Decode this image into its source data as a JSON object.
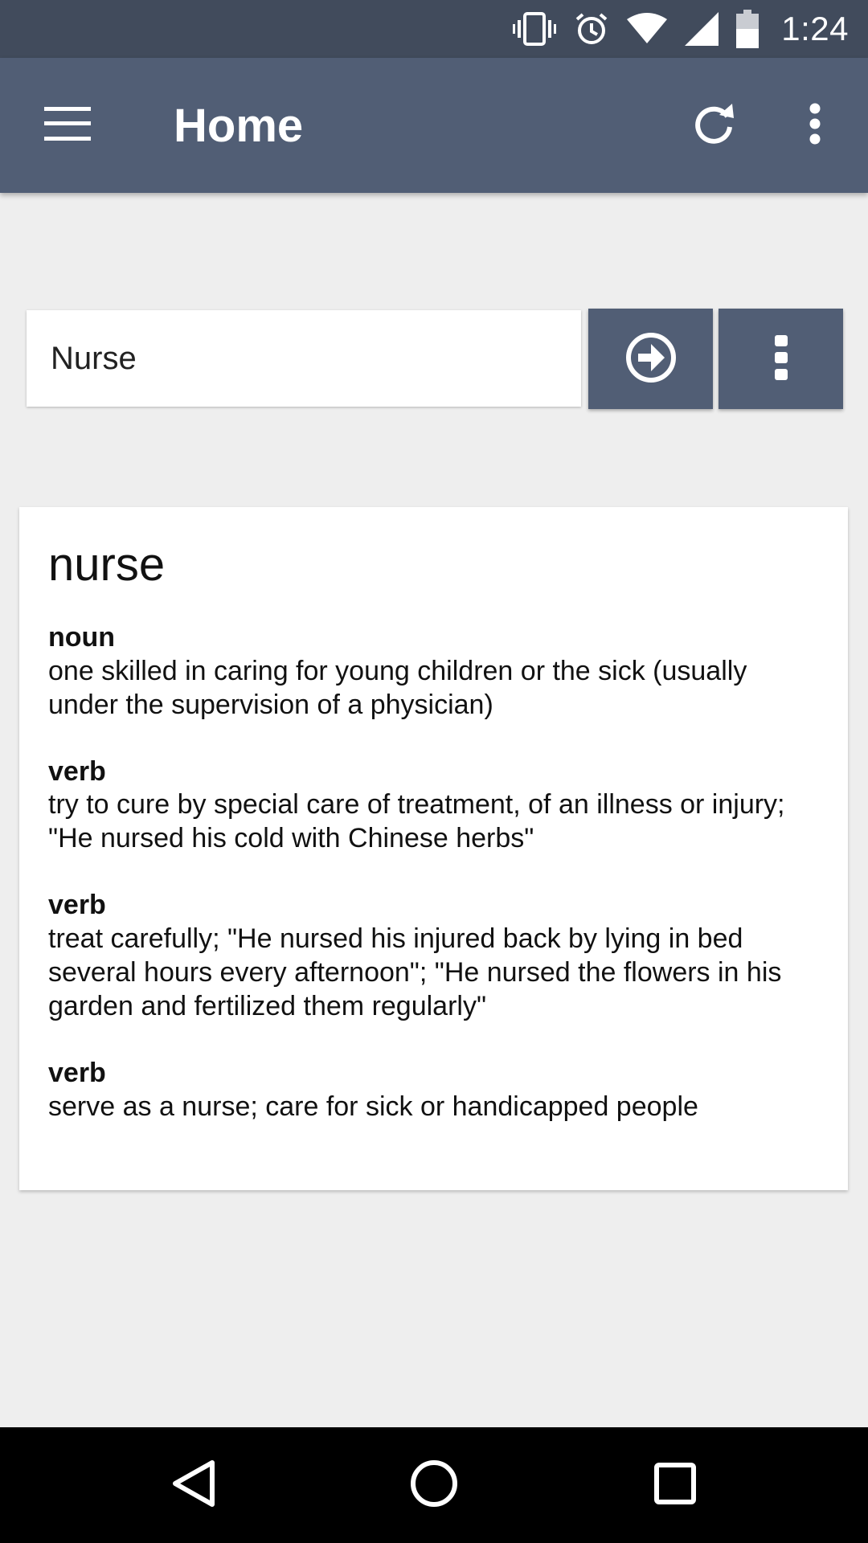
{
  "status_bar": {
    "time": "1:24",
    "icons": [
      "vibrate-icon",
      "alarm-icon",
      "wifi-icon",
      "cell-signal-icon",
      "battery-icon"
    ]
  },
  "app_bar": {
    "title": "Home",
    "icons": [
      "menu-icon",
      "refresh-icon",
      "overflow-menu-icon"
    ]
  },
  "search": {
    "value": "Nurse",
    "go_icon": "arrow-right-circle-icon",
    "more_icon": "overflow-menu-icon"
  },
  "definition": {
    "word": "nurse",
    "senses": [
      {
        "pos": "noun",
        "text": "one skilled in caring for young children or the sick (usually under the supervision of a physician)"
      },
      {
        "pos": "verb",
        "text": "try to cure by special care of treatment, of an illness or injury; \"He nursed his cold with Chinese herbs\""
      },
      {
        "pos": "verb",
        "text": "treat carefully; \"He nursed his injured back by lying in bed several hours every afternoon\"; \"He nursed the flowers in his garden and fertilized them regularly\""
      },
      {
        "pos": "verb",
        "text": "serve as a nurse; care for sick or handicapped people"
      }
    ]
  },
  "nav_bar": {
    "icons": [
      "back-icon",
      "home-icon",
      "recents-icon"
    ]
  },
  "colors": {
    "status_bar": "#414b5c",
    "app_bar": "#515e75",
    "background": "#eeeeee",
    "card": "#ffffff",
    "nav_bar": "#000000"
  }
}
